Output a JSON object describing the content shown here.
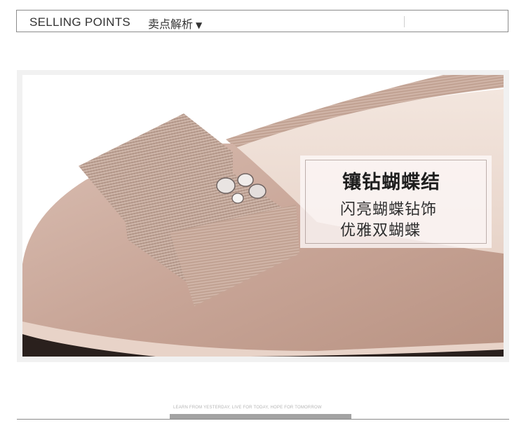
{
  "header": {
    "title": "SELLING POINTS",
    "subtitle": "卖点解析",
    "arrow": "▼"
  },
  "feature": {
    "title": "镶钻蝴蝶结",
    "lines": [
      "闪亮蝴蝶钻饰",
      "优雅双蝴蝶"
    ]
  },
  "photo": {
    "subject": "shoe-toe-with-bow-photo",
    "colors": {
      "suede": "#c9a699",
      "ribbon": "#b89a8c",
      "background": "#ffffff"
    }
  },
  "footer": {
    "tagline": "LEARN FROM YESTERDAY, LIVE FOR TODAY, HOPE FOR TOMORROW"
  }
}
